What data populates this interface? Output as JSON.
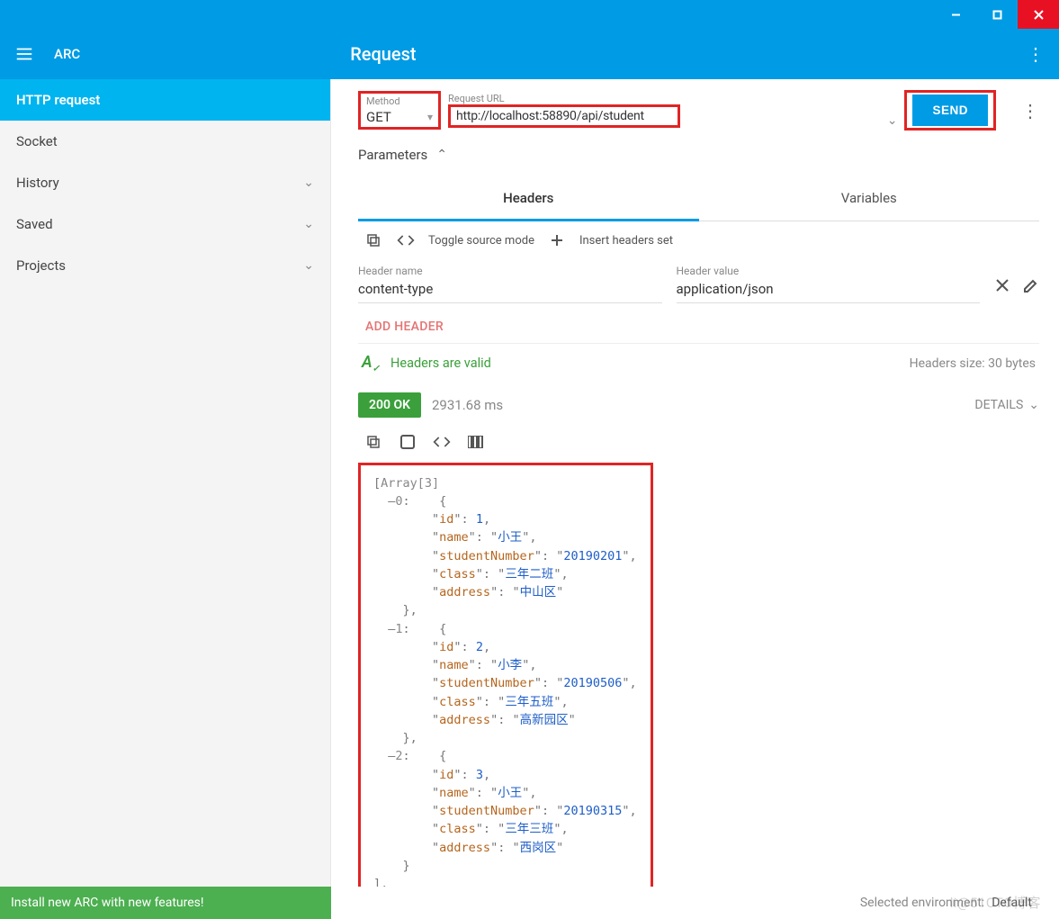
{
  "app": {
    "name": "ARC",
    "page_title": "Request"
  },
  "sidebar": {
    "items": [
      {
        "label": "HTTP request",
        "active": true,
        "expandable": false
      },
      {
        "label": "Socket",
        "active": false,
        "expandable": false
      },
      {
        "label": "History",
        "active": false,
        "expandable": true
      },
      {
        "label": "Saved",
        "active": false,
        "expandable": true
      },
      {
        "label": "Projects",
        "active": false,
        "expandable": true
      }
    ]
  },
  "request": {
    "method_label": "Method",
    "method": "GET",
    "url_label": "Request URL",
    "url": "http://localhost:58890/api/student",
    "send_label": "SEND"
  },
  "parameters_label": "Parameters",
  "tabs": {
    "headers": "Headers",
    "variables": "Variables"
  },
  "header_tools": {
    "toggle_source": "Toggle source mode",
    "insert_set": "Insert headers set"
  },
  "header_row": {
    "name_label": "Header name",
    "name_value": "content-type",
    "value_label": "Header value",
    "value_value": "application/json"
  },
  "add_header_label": "ADD HEADER",
  "validation": {
    "message": "Headers are valid",
    "size": "Headers size: 30 bytes"
  },
  "response": {
    "status": "200 OK",
    "time": "2931.68 ms",
    "details_label": "DETAILS",
    "array_label": "Array[3]",
    "items": [
      {
        "id": 1,
        "name": "小王",
        "studentNumber": "20190201",
        "class": "三年二班",
        "address": "中山区"
      },
      {
        "id": 2,
        "name": "小李",
        "studentNumber": "20190506",
        "class": "三年五班",
        "address": "高新园区"
      },
      {
        "id": 3,
        "name": "小王",
        "studentNumber": "20190315",
        "class": "三年三班",
        "address": "西岗区"
      }
    ]
  },
  "footer": {
    "banner": "Install new ARC with new features!",
    "env_label": "Selected environment:",
    "env_name": "Default"
  },
  "watermark": "li@51CTO博客"
}
